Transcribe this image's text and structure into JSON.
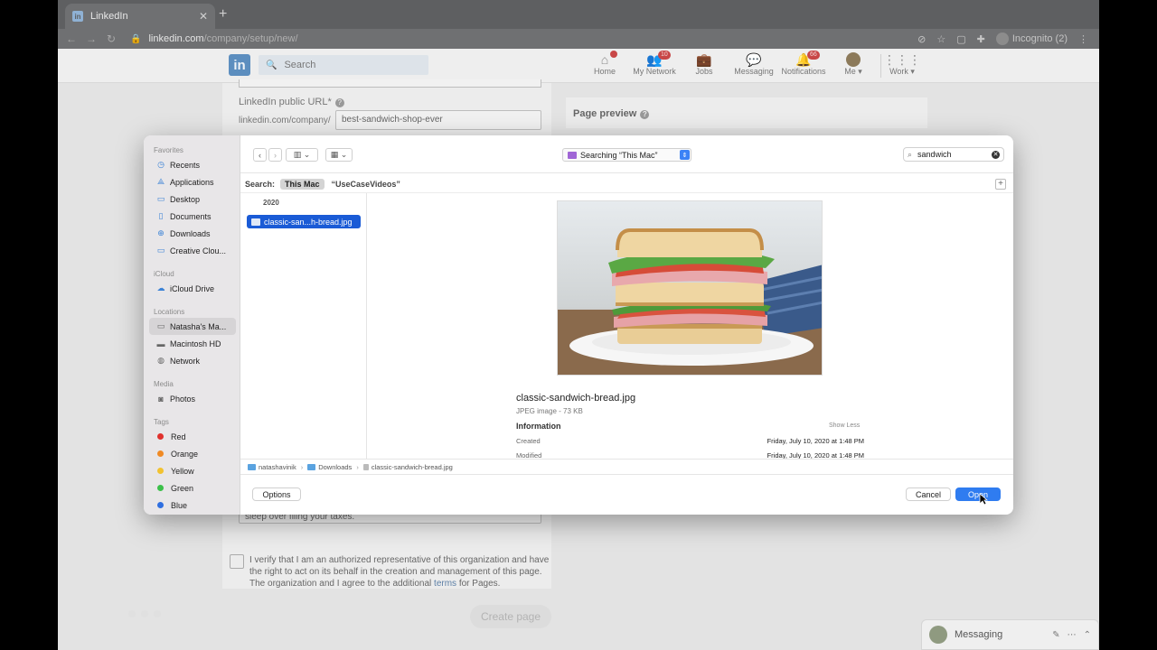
{
  "browser": {
    "tab_title": "LinkedIn",
    "tab_favicon": "in",
    "url_host": "linkedin.com",
    "url_path": "/company/setup/new/",
    "incognito_label": "Incognito (2)"
  },
  "linkedin_nav": {
    "logo": "in",
    "search_placeholder": "Search",
    "items": [
      {
        "label": "Home",
        "icon": "home-icon",
        "badge": ""
      },
      {
        "label": "My Network",
        "icon": "network-icon",
        "badge": "10"
      },
      {
        "label": "Jobs",
        "icon": "jobs-icon",
        "badge": ""
      },
      {
        "label": "Messaging",
        "icon": "messaging-icon",
        "badge": ""
      },
      {
        "label": "Notifications",
        "icon": "bell-icon",
        "badge": "66"
      },
      {
        "label": "Me ▾",
        "icon": "avatar",
        "badge": ""
      },
      {
        "label": "Work ▾",
        "icon": "grid-icon",
        "badge": ""
      }
    ]
  },
  "form": {
    "public_url_label": "LinkedIn public URL*",
    "url_prefix": "linkedin.com/company/",
    "url_value": "best-sandwich-shop-ever",
    "tagline_value": "sleep over filing your taxes.",
    "preview_title": "Page preview",
    "verify_text": "I verify that I am an authorized representative of this organization and have the right to act on its behalf in the creation and management of this page. The organization and I agree to the additional",
    "verify_link": "terms",
    "verify_tail": "for Pages.",
    "create_button": "Create page"
  },
  "messaging_bar": {
    "label": "Messaging"
  },
  "dialog": {
    "sidebar": {
      "sections": [
        {
          "title": "Favorites",
          "items": [
            {
              "label": "Recents",
              "icon": "clock-icon"
            },
            {
              "label": "Applications",
              "icon": "applications-icon"
            },
            {
              "label": "Desktop",
              "icon": "desktop-icon"
            },
            {
              "label": "Documents",
              "icon": "document-icon"
            },
            {
              "label": "Downloads",
              "icon": "download-icon"
            },
            {
              "label": "Creative Clou...",
              "icon": "folder-icon"
            }
          ]
        },
        {
          "title": "iCloud",
          "items": [
            {
              "label": "iCloud Drive",
              "icon": "cloud-icon"
            }
          ]
        },
        {
          "title": "Locations",
          "items": [
            {
              "label": "Natasha's Ma...",
              "icon": "laptop-icon",
              "selected": true
            },
            {
              "label": "Macintosh HD",
              "icon": "disk-icon"
            },
            {
              "label": "Network",
              "icon": "globe-icon"
            }
          ]
        },
        {
          "title": "Media",
          "items": [
            {
              "label": "Photos",
              "icon": "camera-icon"
            }
          ]
        },
        {
          "title": "Tags",
          "items": [
            {
              "label": "Red",
              "color": "#e0312d"
            },
            {
              "label": "Orange",
              "color": "#f08a24"
            },
            {
              "label": "Yellow",
              "color": "#f2c230"
            },
            {
              "label": "Green",
              "color": "#3cc04a"
            },
            {
              "label": "Blue",
              "color": "#2f6fe0"
            }
          ]
        }
      ]
    },
    "location_label": "Searching “This Mac”",
    "search_value": "sandwich",
    "scope": {
      "label": "Search:",
      "selected": "This Mac",
      "alternative": "“UseCaseVideos”"
    },
    "year_header": "2020",
    "file_row": "classic-san...h-bread.jpg",
    "preview": {
      "file_name": "classic-sandwich-bread.jpg",
      "file_kind": "JPEG image - 73 KB",
      "info_title": "Information",
      "show_less": "Show Less",
      "rows": [
        {
          "label": "Created",
          "value": "Friday, July 10, 2020 at 1:48 PM"
        },
        {
          "label": "Modified",
          "value": "Friday, July 10, 2020 at 1:48 PM"
        }
      ]
    },
    "path": [
      "natashavinik",
      "Downloads",
      "classic-sandwich-bread.jpg"
    ],
    "buttons": {
      "options": "Options",
      "cancel": "Cancel",
      "open": "Open"
    }
  }
}
